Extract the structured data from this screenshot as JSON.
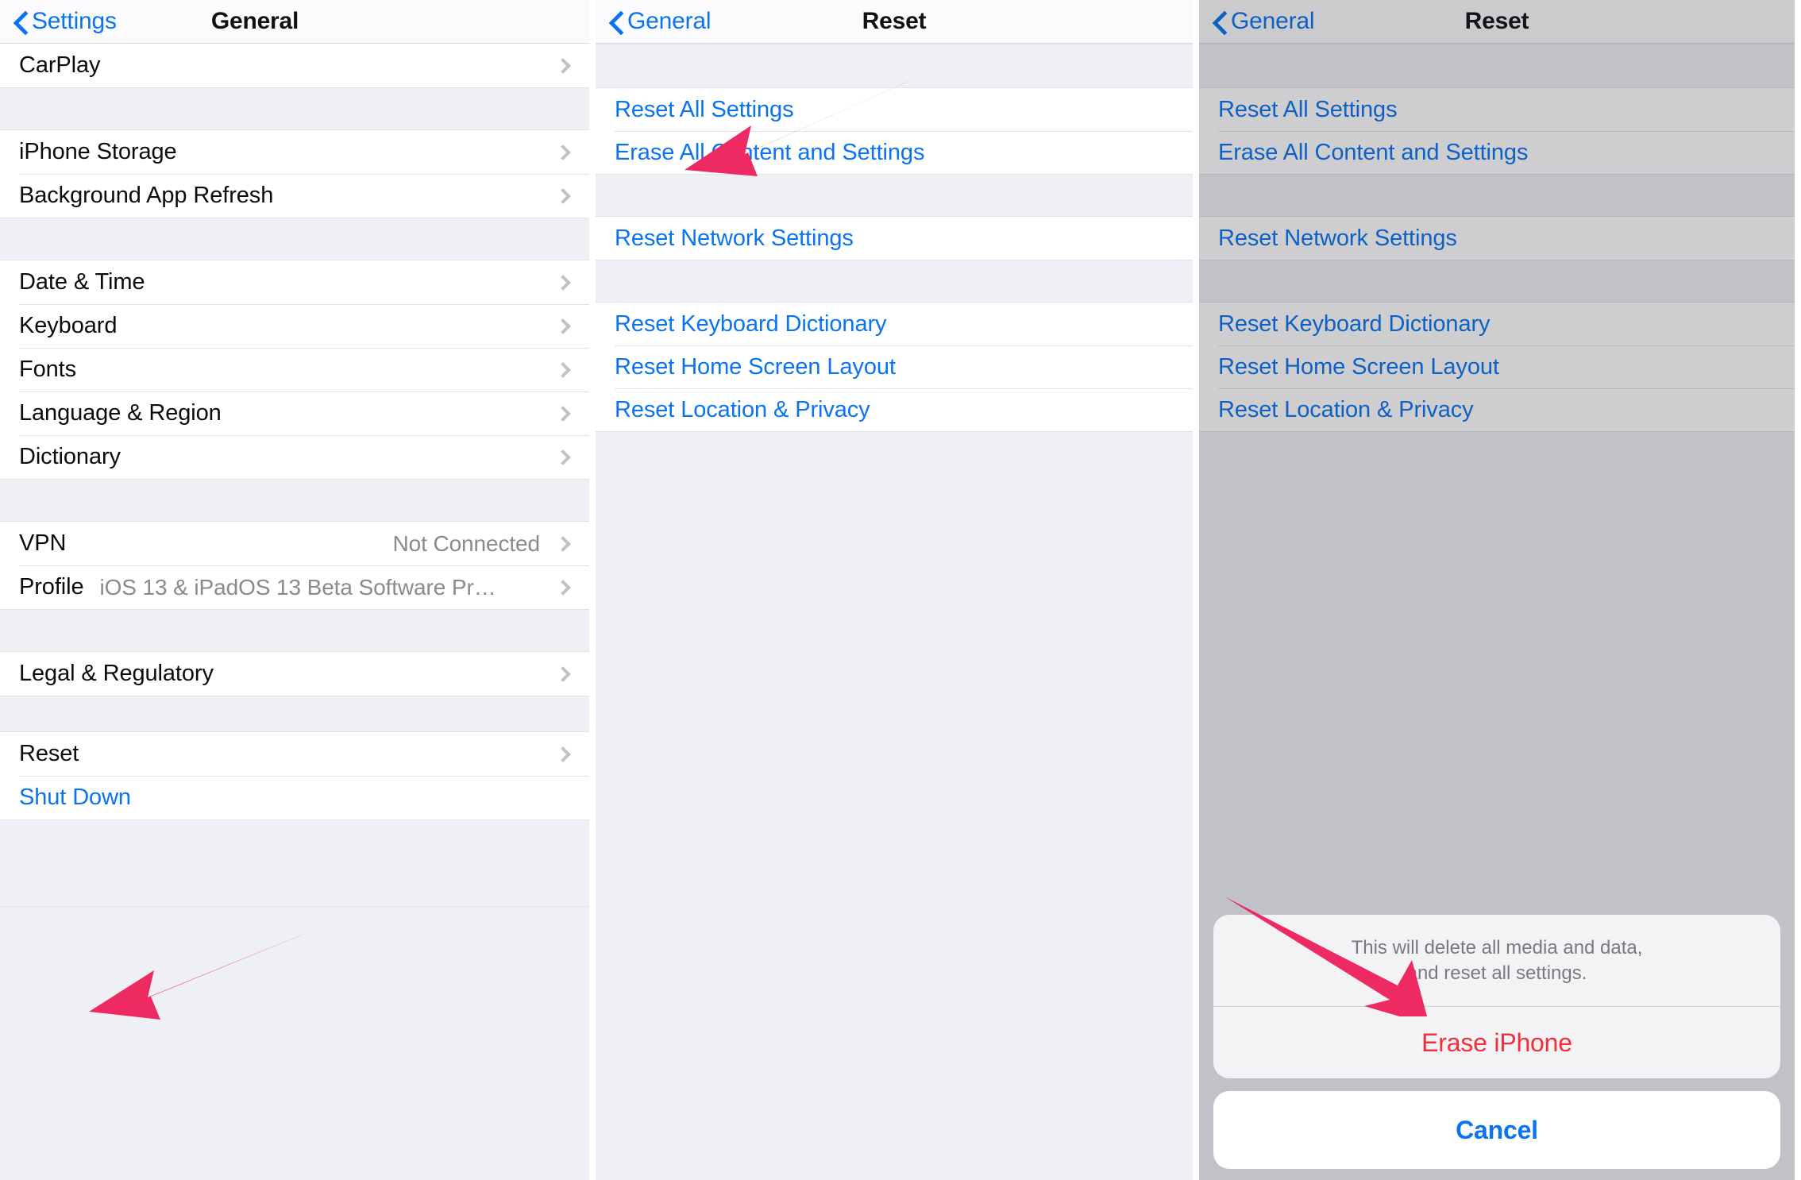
{
  "accent": {
    "link_blue": "#0a74f0",
    "destructive_red": "#f0313d",
    "annotation_pink": "#ee2a62",
    "group_bg": "#eff0f5",
    "row_bg": "#ffffff"
  },
  "panels": [
    {
      "id": "general-settings",
      "nav": {
        "back_label": "Settings",
        "title": "General",
        "back_icon": "chevron-left-icon"
      },
      "sections": [
        {
          "rows": [
            {
              "label": "CarPlay",
              "value": "",
              "accessory": "chevron-right-icon",
              "style": "default"
            }
          ]
        },
        {
          "rows": [
            {
              "label": "iPhone Storage",
              "value": "",
              "accessory": "chevron-right-icon",
              "style": "default"
            },
            {
              "label": "Background App Refresh",
              "value": "",
              "accessory": "chevron-right-icon",
              "style": "default"
            }
          ]
        },
        {
          "rows": [
            {
              "label": "Date & Time",
              "value": "",
              "accessory": "chevron-right-icon",
              "style": "default"
            },
            {
              "label": "Keyboard",
              "value": "",
              "accessory": "chevron-right-icon",
              "style": "default"
            },
            {
              "label": "Fonts",
              "value": "",
              "accessory": "chevron-right-icon",
              "style": "default"
            },
            {
              "label": "Language & Region",
              "value": "",
              "accessory": "chevron-right-icon",
              "style": "default"
            },
            {
              "label": "Dictionary",
              "value": "",
              "accessory": "chevron-right-icon",
              "style": "default"
            }
          ]
        },
        {
          "rows": [
            {
              "label": "VPN",
              "value": "Not Connected",
              "accessory": "chevron-right-icon",
              "style": "default"
            },
            {
              "label": "Profile",
              "value": "iOS 13 & iPadOS 13 Beta Software Pr…",
              "accessory": "chevron-right-icon",
              "style": "value-inline"
            }
          ]
        },
        {
          "rows": [
            {
              "label": "Legal & Regulatory",
              "value": "",
              "accessory": "chevron-right-icon",
              "style": "default"
            }
          ]
        },
        {
          "rows": [
            {
              "label": "Reset",
              "value": "",
              "accessory": "chevron-right-icon",
              "style": "default"
            },
            {
              "label": "Shut Down",
              "value": "",
              "accessory": "",
              "style": "link"
            }
          ]
        }
      ]
    },
    {
      "id": "reset-screen",
      "nav": {
        "back_label": "General",
        "title": "Reset",
        "back_icon": "chevron-left-icon"
      },
      "sections": [
        {
          "rows": [
            {
              "label": "Reset All Settings",
              "value": "",
              "accessory": "",
              "style": "link"
            },
            {
              "label": "Erase All Content and Settings",
              "value": "",
              "accessory": "",
              "style": "link"
            }
          ]
        },
        {
          "rows": [
            {
              "label": "Reset Network Settings",
              "value": "",
              "accessory": "",
              "style": "link"
            }
          ]
        },
        {
          "rows": [
            {
              "label": "Reset Keyboard Dictionary",
              "value": "",
              "accessory": "",
              "style": "link"
            },
            {
              "label": "Reset Home Screen Layout",
              "value": "",
              "accessory": "",
              "style": "link"
            },
            {
              "label": "Reset Location & Privacy",
              "value": "",
              "accessory": "",
              "style": "link"
            }
          ]
        }
      ]
    },
    {
      "id": "reset-screen-dimmed",
      "nav": {
        "back_label": "General",
        "title": "Reset",
        "back_icon": "chevron-left-icon"
      },
      "sections": [
        {
          "rows": [
            {
              "label": "Reset All Settings",
              "value": "",
              "accessory": "",
              "style": "link"
            },
            {
              "label": "Erase All Content and Settings",
              "value": "",
              "accessory": "",
              "style": "link"
            }
          ]
        },
        {
          "rows": [
            {
              "label": "Reset Network Settings",
              "value": "",
              "accessory": "",
              "style": "link"
            }
          ]
        },
        {
          "rows": [
            {
              "label": "Reset Keyboard Dictionary",
              "value": "",
              "accessory": "",
              "style": "link"
            },
            {
              "label": "Reset Home Screen Layout",
              "value": "",
              "accessory": "",
              "style": "link"
            },
            {
              "label": "Reset Location & Privacy",
              "value": "",
              "accessory": "",
              "style": "link"
            }
          ]
        }
      ],
      "action_sheet": {
        "message_line1": "This will delete all media and data,",
        "message_line2": "and reset all settings.",
        "destructive_label": "Erase iPhone",
        "cancel_label": "Cancel"
      }
    }
  ],
  "annotations": [
    {
      "name": "arrow-pointing-to-reset",
      "target": "Reset"
    },
    {
      "name": "arrow-pointing-to-erase-all-content-and-settings",
      "target": "Erase All Content and Settings"
    },
    {
      "name": "arrow-pointing-to-erase-iphone",
      "target": "Erase iPhone"
    }
  ]
}
